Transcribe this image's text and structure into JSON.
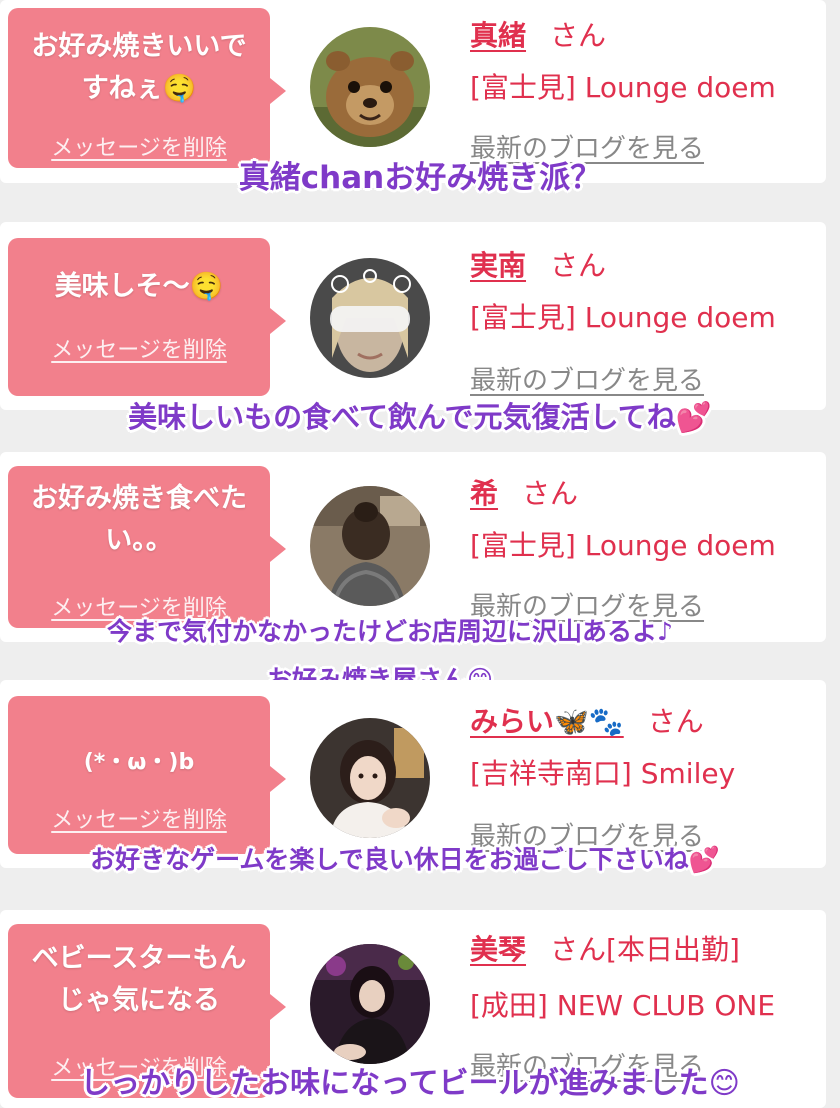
{
  "colors": {
    "accent": "#e0304e",
    "bubble": "#f2808c",
    "caption": "#7f3ac8",
    "link_gray": "#888888",
    "background": "#eeeeee"
  },
  "entries": [
    {
      "message": "お好み焼きいいで\nすねぇ🤤",
      "delete_label": "メッセージを削除",
      "name": "真緒",
      "san": "さん",
      "suffix": "",
      "store": "[富士見] Lounge doem",
      "blog_label": "最新のブログを見る",
      "avatar": "quokka-photo",
      "caption": "真緒chanお好み焼き派？"
    },
    {
      "message": "美味しそ〜🤤",
      "delete_label": "メッセージを削除",
      "name": "実南",
      "san": "さん",
      "suffix": "",
      "store": "[富士見] Lounge doem",
      "blog_label": "最新のブログを見る",
      "avatar": "blurred-face-photo",
      "caption": "美味しいもの食べて飲んで元気復活してね💕"
    },
    {
      "message": "お好み焼き食べた\nい。。",
      "delete_label": "メッセージを削除",
      "name": "希",
      "san": "さん",
      "suffix": "",
      "store": "[富士見] Lounge doem",
      "blog_label": "最新のブログを見る",
      "avatar": "hair-back-photo",
      "caption": "今まで気付かなかったけどお店周辺に沢山あるよ♪",
      "caption2": "お好み焼き屋さん😊"
    },
    {
      "message": "(*・ω・)b",
      "delete_label": "メッセージを削除",
      "name": "みらい🦋🐾",
      "san": "さん",
      "suffix": "",
      "store": "[吉祥寺南口] Smiley",
      "blog_label": "最新のブログを見る",
      "avatar": "girl-selfie-photo",
      "caption": "お好きなゲームを楽しで良い休日をお過ごし下さいね💕"
    },
    {
      "message": "ベビースターもん\nじゃ気になる",
      "delete_label": "メッセージを削除",
      "name": "美琴",
      "san": "さん",
      "suffix": "[本日出勤]",
      "store": "[成田] NEW CLUB ONE",
      "blog_label": "最新のブログを見る",
      "avatar": "dark-dress-photo",
      "caption": "しっかりしたお味になってビールが進みました😊"
    }
  ]
}
